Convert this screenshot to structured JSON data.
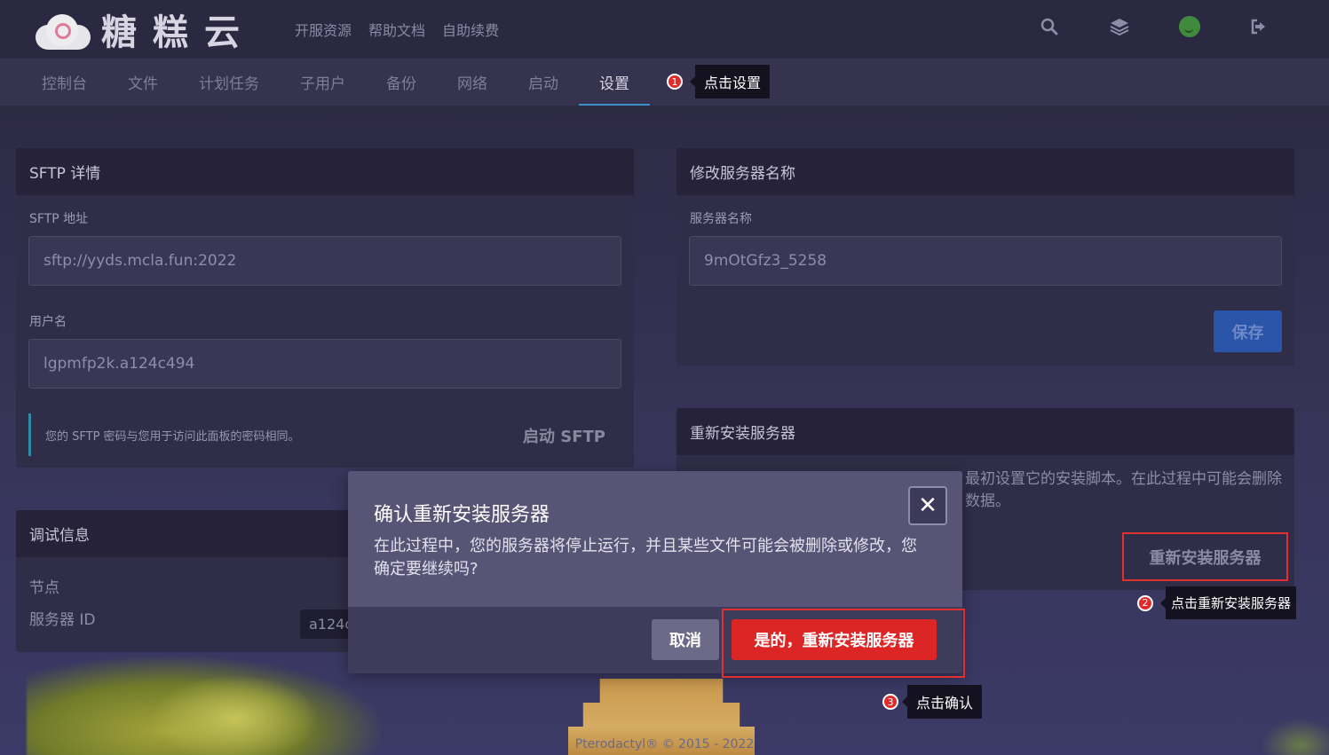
{
  "brand": {
    "name": "糖糕云"
  },
  "top_links": [
    "开服资源",
    "帮助文档",
    "自助续费"
  ],
  "top_icons": [
    "search-icon",
    "layers-icon",
    "avatar",
    "logout-icon"
  ],
  "tabs": [
    {
      "label": "控制台",
      "active": false
    },
    {
      "label": "文件",
      "active": false
    },
    {
      "label": "计划任务",
      "active": false
    },
    {
      "label": "子用户",
      "active": false
    },
    {
      "label": "备份",
      "active": false
    },
    {
      "label": "网络",
      "active": false
    },
    {
      "label": "启动",
      "active": false
    },
    {
      "label": "设置",
      "active": true
    }
  ],
  "annotations": [
    {
      "num": "1",
      "text": "点击设置"
    },
    {
      "num": "2",
      "text": "点击重新安装服务器"
    },
    {
      "num": "3",
      "text": "点击确认"
    }
  ],
  "sftp": {
    "title": "SFTP 详情",
    "address_label": "SFTP 地址",
    "address_value": "sftp://yyds.mcla.fun:2022",
    "username_label": "用户名",
    "username_value": "lgpmfp2k.a124c494",
    "note": "您的 SFTP 密码与您用于访问此面板的密码相同。",
    "launch_label": "启动 SFTP"
  },
  "rename": {
    "title": "修改服务器名称",
    "name_label": "服务器名称",
    "name_value": "9mOtGfz3_5258",
    "save_label": "保存"
  },
  "reinstall": {
    "title": "重新安装服务器",
    "body_visible": "最初设置它的安装脚本。在此过程中可能会删除\n数据。",
    "button_label": "重新安装服务器"
  },
  "debug": {
    "title": "调试信息",
    "node_label": "节点",
    "server_id_label": "服务器 ID",
    "server_id_value": "a124c"
  },
  "modal": {
    "title": "确认重新安装服务器",
    "text": "在此过程中，您的服务器将停止运行，并且某些文件可能会被删除或修改，您确定要继续吗?",
    "cancel_label": "取消",
    "confirm_label": "是的，重新安装服务器",
    "close_symbol": "✕"
  },
  "footer": {
    "text": "Pterodactyl® © 2015 - 2022"
  },
  "colors": {
    "accent": "#3a8ec9",
    "danger": "#dc2626",
    "primary": "#2b55a8"
  }
}
